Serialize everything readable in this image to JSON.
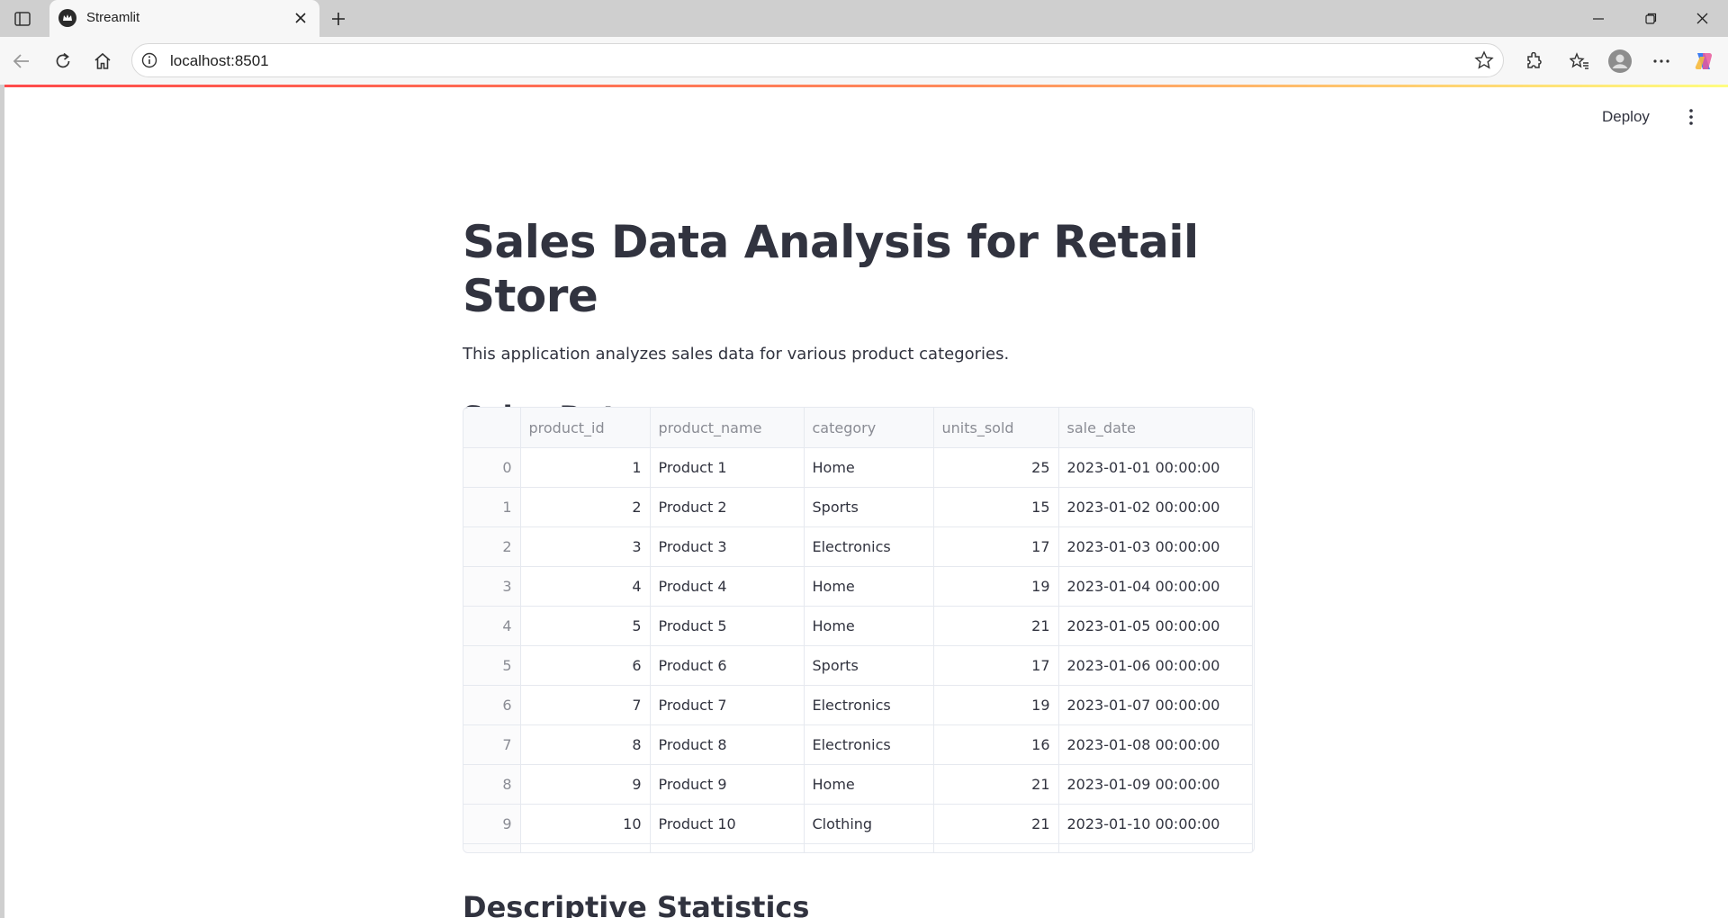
{
  "browser": {
    "tab_title": "Streamlit",
    "url": "localhost:8501"
  },
  "app": {
    "deploy_label": "Deploy",
    "title": "Sales Data Analysis for Retail Store",
    "description": "This application analyzes sales data for various product categories.",
    "section_sales": "Sales Data",
    "section_stats": "Descriptive Statistics"
  },
  "table": {
    "columns": [
      "",
      "product_id",
      "product_name",
      "category",
      "units_sold",
      "sale_date"
    ],
    "rows": [
      [
        "0",
        "1",
        "Product 1",
        "Home",
        "25",
        "2023-01-01 00:00:00"
      ],
      [
        "1",
        "2",
        "Product 2",
        "Sports",
        "15",
        "2023-01-02 00:00:00"
      ],
      [
        "2",
        "3",
        "Product 3",
        "Electronics",
        "17",
        "2023-01-03 00:00:00"
      ],
      [
        "3",
        "4",
        "Product 4",
        "Home",
        "19",
        "2023-01-04 00:00:00"
      ],
      [
        "4",
        "5",
        "Product 5",
        "Home",
        "21",
        "2023-01-05 00:00:00"
      ],
      [
        "5",
        "6",
        "Product 6",
        "Sports",
        "17",
        "2023-01-06 00:00:00"
      ],
      [
        "6",
        "7",
        "Product 7",
        "Electronics",
        "19",
        "2023-01-07 00:00:00"
      ],
      [
        "7",
        "8",
        "Product 8",
        "Electronics",
        "16",
        "2023-01-08 00:00:00"
      ],
      [
        "8",
        "9",
        "Product 9",
        "Home",
        "21",
        "2023-01-09 00:00:00"
      ],
      [
        "9",
        "10",
        "Product 10",
        "Clothing",
        "21",
        "2023-01-10 00:00:00"
      ]
    ]
  },
  "colors": {
    "accent_red": "#ff4b4b",
    "text": "#31333f",
    "muted": "#8a8c94"
  }
}
